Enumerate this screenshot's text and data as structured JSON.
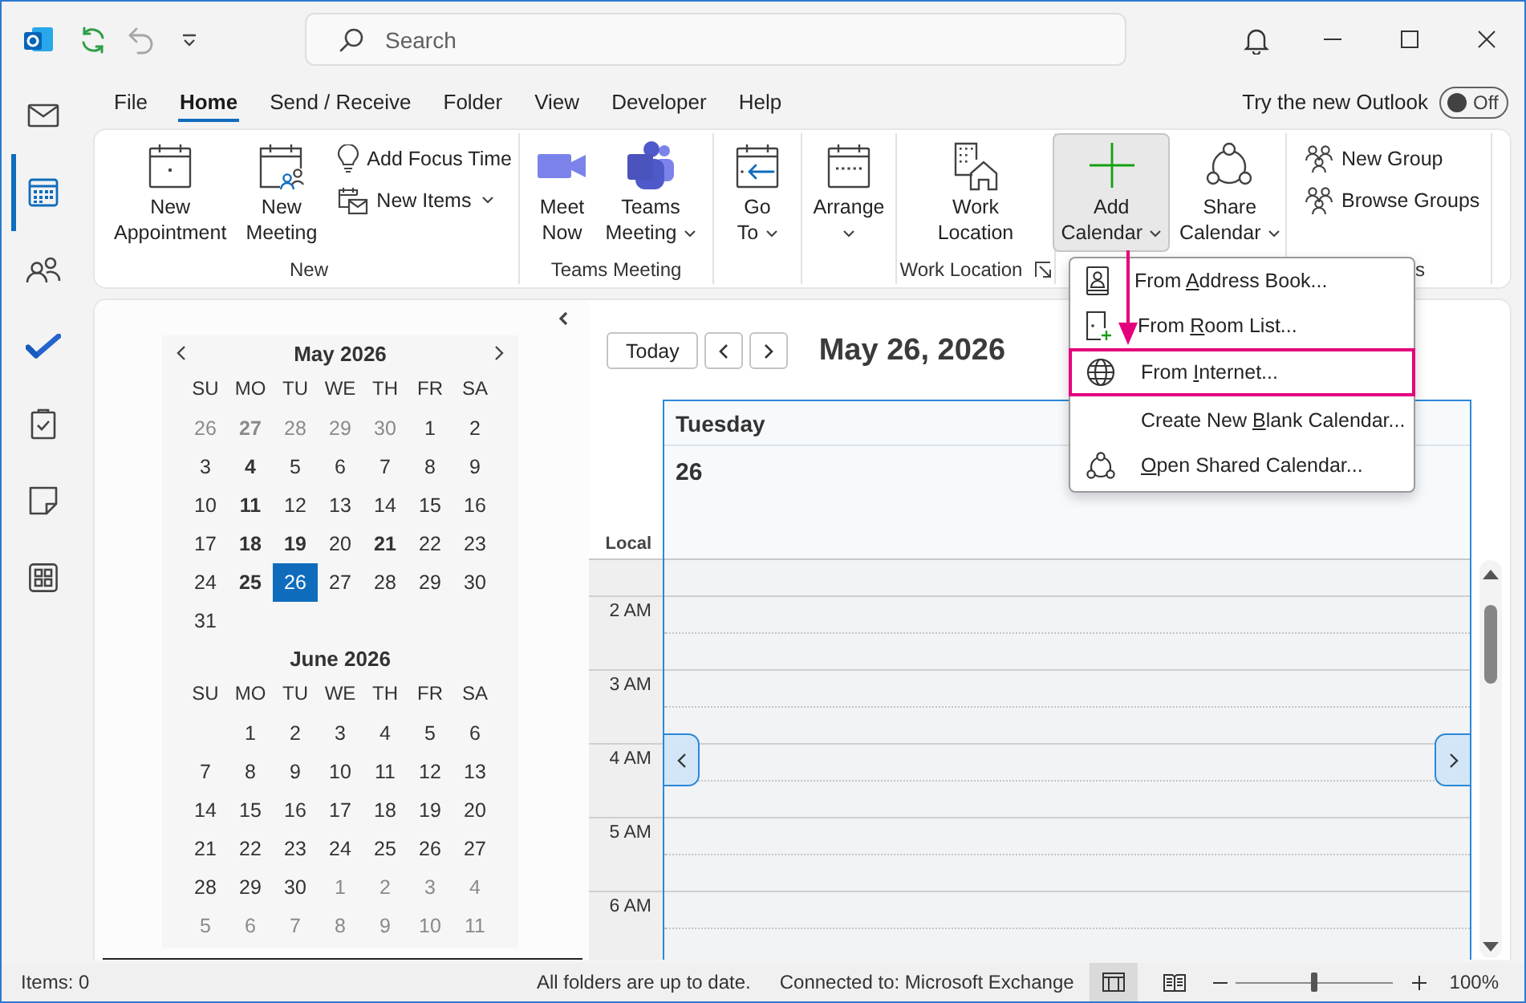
{
  "title_bar": {
    "quick_access": [
      {
        "disabled": false
      },
      {
        "disabled": true
      },
      {
        "disabled": false
      }
    ],
    "search": {
      "placeholder": "Search"
    }
  },
  "nav_rail": [
    {
      "selected": false
    },
    {
      "selected": true
    },
    {
      "selected": false
    },
    {
      "selected": false
    },
    {
      "selected": false
    },
    {
      "selected": false
    },
    {
      "selected": false
    }
  ],
  "tabs": [
    {
      "label": "File",
      "selected": false
    },
    {
      "label": "Home",
      "selected": true
    },
    {
      "label": "Send / Receive",
      "selected": false
    },
    {
      "label": "Folder",
      "selected": false
    },
    {
      "label": "View",
      "selected": false
    },
    {
      "label": "Developer",
      "selected": false
    },
    {
      "label": "Help",
      "selected": false
    }
  ],
  "try_new_outlook": {
    "label": "Try the new Outlook",
    "toggle": {
      "on": false,
      "label": "Off"
    }
  },
  "ribbon": {
    "groups": [
      {
        "label": "New",
        "buttons": [
          {
            "kind": "large",
            "label": "New Appointment",
            "dropdown": false,
            "pressed": false
          },
          {
            "kind": "large",
            "label": "New Meeting",
            "dropdown": false,
            "pressed": false
          },
          {
            "kind": "small",
            "label": "Add Focus Time",
            "dropdown": false,
            "pressed": false
          },
          {
            "kind": "small",
            "label": "New Items",
            "dropdown": true,
            "pressed": false
          }
        ]
      },
      {
        "label": "Teams Meeting",
        "buttons": [
          {
            "kind": "large",
            "label": "Meet Now",
            "dropdown": false,
            "pressed": false
          },
          {
            "kind": "large",
            "label": "Teams Meeting",
            "dropdown": true,
            "pressed": false
          }
        ]
      },
      {
        "buttons": [
          {
            "kind": "large",
            "label": "Go To",
            "dropdown": true,
            "pressed": false
          }
        ]
      },
      {
        "buttons": [
          {
            "kind": "large",
            "label": "Arrange",
            "dropdown": true,
            "pressed": false
          }
        ]
      },
      {
        "label": "Work Location",
        "launcher": true,
        "buttons": [
          {
            "kind": "large",
            "label": "Work Location",
            "dropdown": false,
            "pressed": false
          }
        ]
      },
      {
        "buttons": [
          {
            "kind": "large",
            "label": "Add Calendar",
            "dropdown": true,
            "pressed": true
          },
          {
            "kind": "large",
            "label": "Share Calendar",
            "dropdown": true,
            "pressed": false
          }
        ]
      },
      {
        "label": "s",
        "buttons": [
          {
            "kind": "small",
            "label": "New Group",
            "dropdown": false,
            "pressed": false
          },
          {
            "kind": "small",
            "label": "Browse Groups",
            "dropdown": false,
            "pressed": false
          }
        ]
      }
    ]
  },
  "menu": {
    "callout_arrow": true,
    "items": [
      {
        "before": "From ",
        "key": "A",
        "after": "ddress Book...",
        "highlighted": false
      },
      {
        "before": "From ",
        "key": "R",
        "after": "oom List...",
        "highlighted": false
      },
      {
        "before": "From ",
        "key": "I",
        "after": "nternet...",
        "highlighted": true
      },
      {
        "before": "Create New ",
        "key": "B",
        "after": "lank Calendar...",
        "highlighted": false
      },
      {
        "key": "O",
        "after": "pen Shared Calendar...",
        "highlighted": false
      }
    ]
  },
  "calendar_pane": {
    "months": [
      {
        "title": "May 2026",
        "weekdays": [
          "SU",
          "MO",
          "TU",
          "WE",
          "TH",
          "FR",
          "SA"
        ],
        "weeks": [
          [
            {
              "day": "26",
              "other_month": true,
              "busy": false,
              "selected": false
            },
            {
              "day": "27",
              "other_month": true,
              "busy": true,
              "selected": false
            },
            {
              "day": "28",
              "other_month": true,
              "busy": false,
              "selected": false
            },
            {
              "day": "29",
              "other_month": true,
              "busy": false,
              "selected": false
            },
            {
              "day": "30",
              "other_month": true,
              "busy": false,
              "selected": false
            },
            {
              "day": "1",
              "other_month": false,
              "busy": false,
              "selected": false
            },
            {
              "day": "2",
              "other_month": false,
              "busy": false,
              "selected": false
            }
          ],
          [
            {
              "day": "3",
              "other_month": false,
              "busy": false,
              "selected": false
            },
            {
              "day": "4",
              "other_month": false,
              "busy": true,
              "selected": false
            },
            {
              "day": "5",
              "other_month": false,
              "busy": false,
              "selected": false
            },
            {
              "day": "6",
              "other_month": false,
              "busy": false,
              "selected": false
            },
            {
              "day": "7",
              "other_month": false,
              "busy": false,
              "selected": false
            },
            {
              "day": "8",
              "other_month": false,
              "busy": false,
              "selected": false
            },
            {
              "day": "9",
              "other_month": false,
              "busy": false,
              "selected": false
            }
          ],
          [
            {
              "day": "10",
              "other_month": false,
              "busy": false,
              "selected": false
            },
            {
              "day": "11",
              "other_month": false,
              "busy": true,
              "selected": false
            },
            {
              "day": "12",
              "other_month": false,
              "busy": false,
              "selected": false
            },
            {
              "day": "13",
              "other_month": false,
              "busy": false,
              "selected": false
            },
            {
              "day": "14",
              "other_month": false,
              "busy": false,
              "selected": false
            },
            {
              "day": "15",
              "other_month": false,
              "busy": false,
              "selected": false
            },
            {
              "day": "16",
              "other_month": false,
              "busy": false,
              "selected": false
            }
          ],
          [
            {
              "day": "17",
              "other_month": false,
              "busy": false,
              "selected": false
            },
            {
              "day": "18",
              "other_month": false,
              "busy": true,
              "selected": false
            },
            {
              "day": "19",
              "other_month": false,
              "busy": true,
              "selected": false
            },
            {
              "day": "20",
              "other_month": false,
              "busy": false,
              "selected": false
            },
            {
              "day": "21",
              "other_month": false,
              "busy": true,
              "selected": false
            },
            {
              "day": "22",
              "other_month": false,
              "busy": false,
              "selected": false
            },
            {
              "day": "23",
              "other_month": false,
              "busy": false,
              "selected": false
            }
          ],
          [
            {
              "day": "24",
              "other_month": false,
              "busy": false,
              "selected": false
            },
            {
              "day": "25",
              "other_month": false,
              "busy": true,
              "selected": false
            },
            {
              "day": "26",
              "other_month": false,
              "busy": false,
              "selected": true
            },
            {
              "day": "27",
              "other_month": false,
              "busy": false,
              "selected": false
            },
            {
              "day": "28",
              "other_month": false,
              "busy": false,
              "selected": false
            },
            {
              "day": "29",
              "other_month": false,
              "busy": false,
              "selected": false
            },
            {
              "day": "30",
              "other_month": false,
              "busy": false,
              "selected": false
            }
          ],
          [
            {
              "day": "31",
              "other_month": false,
              "busy": false,
              "selected": false
            }
          ]
        ]
      },
      {
        "title": "June 2026",
        "weekdays": [
          "SU",
          "MO",
          "TU",
          "WE",
          "TH",
          "FR",
          "SA"
        ],
        "weeks": [
          [
            {
              "day": "1",
              "other_month": false,
              "busy": false,
              "selected": false
            },
            {
              "day": "2",
              "other_month": false,
              "busy": false,
              "selected": false
            },
            {
              "day": "3",
              "other_month": false,
              "busy": false,
              "selected": false
            },
            {
              "day": "4",
              "other_month": false,
              "busy": false,
              "selected": false
            },
            {
              "day": "5",
              "other_month": false,
              "busy": false,
              "selected": false
            },
            {
              "day": "6",
              "other_month": false,
              "busy": false,
              "selected": false
            }
          ],
          [
            {
              "day": "7",
              "other_month": false,
              "busy": false,
              "selected": false
            },
            {
              "day": "8",
              "other_month": false,
              "busy": false,
              "selected": false
            },
            {
              "day": "9",
              "other_month": false,
              "busy": false,
              "selected": false
            },
            {
              "day": "10",
              "other_month": false,
              "busy": false,
              "selected": false
            },
            {
              "day": "11",
              "other_month": false,
              "busy": false,
              "selected": false
            },
            {
              "day": "12",
              "other_month": false,
              "busy": false,
              "selected": false
            },
            {
              "day": "13",
              "other_month": false,
              "busy": false,
              "selected": false
            }
          ],
          [
            {
              "day": "14",
              "other_month": false,
              "busy": false,
              "selected": false
            },
            {
              "day": "15",
              "other_month": false,
              "busy": false,
              "selected": false
            },
            {
              "day": "16",
              "other_month": false,
              "busy": false,
              "selected": false
            },
            {
              "day": "17",
              "other_month": false,
              "busy": false,
              "selected": false
            },
            {
              "day": "18",
              "other_month": false,
              "busy": false,
              "selected": false
            },
            {
              "day": "19",
              "other_month": false,
              "busy": false,
              "selected": false
            },
            {
              "day": "20",
              "other_month": false,
              "busy": false,
              "selected": false
            }
          ],
          [
            {
              "day": "21",
              "other_month": false,
              "busy": false,
              "selected": false
            },
            {
              "day": "22",
              "other_month": false,
              "busy": false,
              "selected": false
            },
            {
              "day": "23",
              "other_month": false,
              "busy": false,
              "selected": false
            },
            {
              "day": "24",
              "other_month": false,
              "busy": false,
              "selected": false
            },
            {
              "day": "25",
              "other_month": false,
              "busy": false,
              "selected": false
            },
            {
              "day": "26",
              "other_month": false,
              "busy": false,
              "selected": false
            },
            {
              "day": "27",
              "other_month": false,
              "busy": false,
              "selected": false
            }
          ],
          [
            {
              "day": "28",
              "other_month": false,
              "busy": false,
              "selected": false
            },
            {
              "day": "29",
              "other_month": false,
              "busy": false,
              "selected": false
            },
            {
              "day": "30",
              "other_month": false,
              "busy": false,
              "selected": false
            },
            {
              "day": "1",
              "other_month": true,
              "busy": false,
              "selected": false
            },
            {
              "day": "2",
              "other_month": true,
              "busy": false,
              "selected": false
            },
            {
              "day": "3",
              "other_month": true,
              "busy": false,
              "selected": false
            },
            {
              "day": "4",
              "other_month": true,
              "busy": false,
              "selected": false
            }
          ],
          [
            {
              "day": "5",
              "other_month": true,
              "busy": false,
              "selected": false
            },
            {
              "day": "6",
              "other_month": true,
              "busy": false,
              "selected": false
            },
            {
              "day": "7",
              "other_month": true,
              "busy": false,
              "selected": false
            },
            {
              "day": "8",
              "other_month": true,
              "busy": false,
              "selected": false
            },
            {
              "day": "9",
              "other_month": true,
              "busy": false,
              "selected": false
            },
            {
              "day": "10",
              "other_month": true,
              "busy": false,
              "selected": false
            },
            {
              "day": "11",
              "other_month": true,
              "busy": false,
              "selected": false
            }
          ]
        ]
      }
    ]
  },
  "day_view": {
    "today_button": "Today",
    "date": "May 26, 2026",
    "day_name": "Tuesday",
    "day_number": "26",
    "time_zone_label": "Local",
    "hours": [
      "2 AM",
      "3 AM",
      "4 AM",
      "5 AM",
      "6 AM"
    ]
  },
  "status_bar": {
    "items": "Items: 0",
    "sync_status": "All folders are up to date.",
    "connection": "Connected to: Microsoft Exchange",
    "views": [
      {
        "selected": true
      },
      {
        "selected": false
      }
    ],
    "zoom": {
      "level": 0.5,
      "reading": "100%"
    }
  }
}
